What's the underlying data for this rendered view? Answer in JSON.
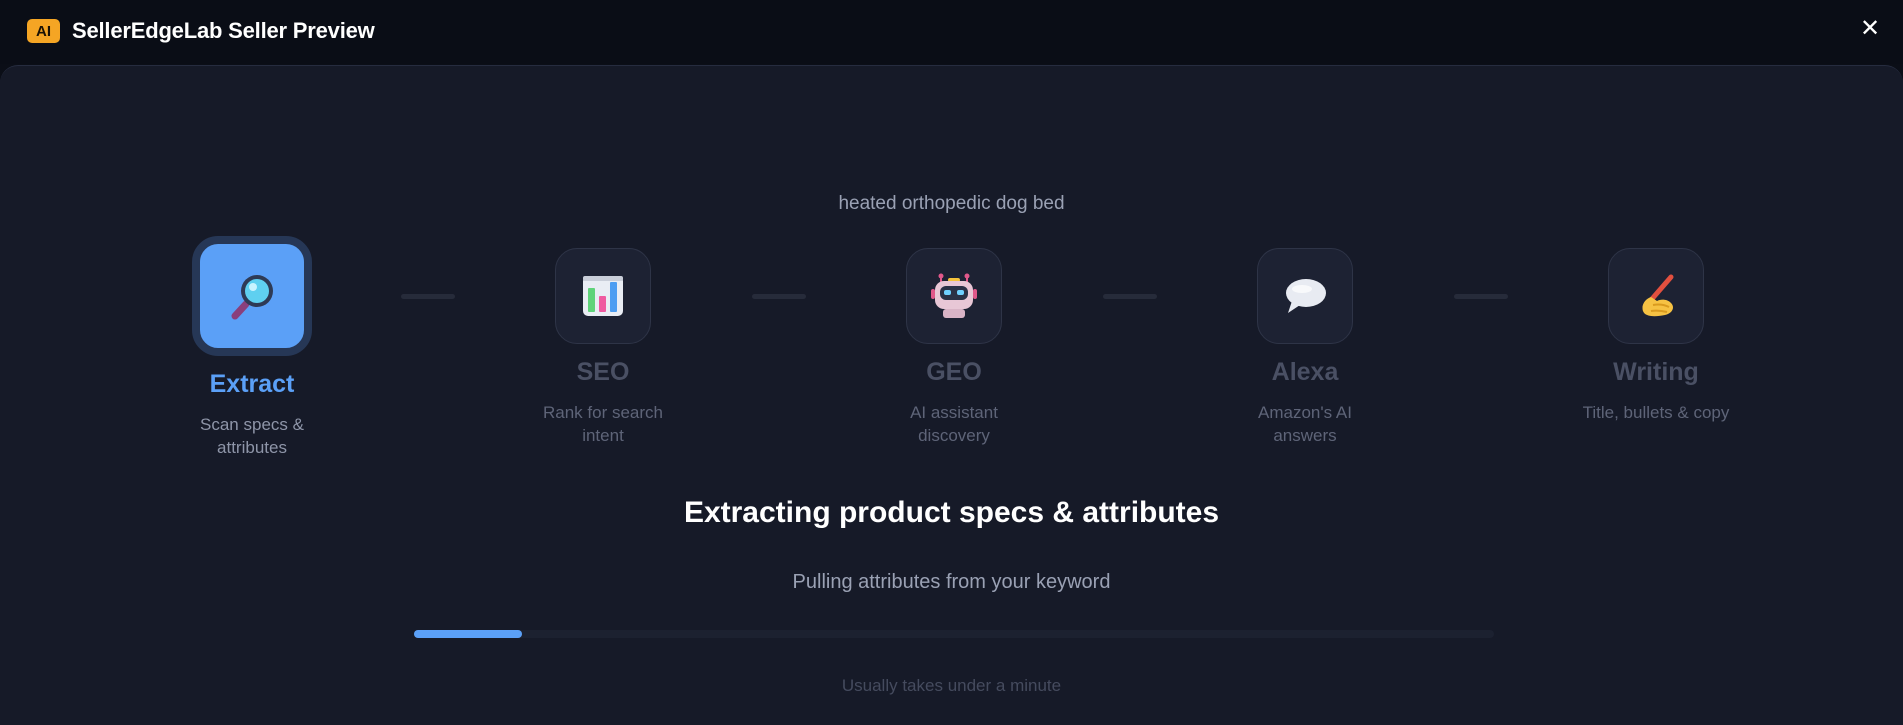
{
  "header": {
    "badge": "AI",
    "title": "SellerEdgeLab Seller Preview",
    "close_icon": "close-icon"
  },
  "keyword": "heated orthopedic dog bed",
  "steps": [
    {
      "label": "Extract",
      "description": "Scan specs & attributes",
      "icon": "magnifier-icon",
      "active": true
    },
    {
      "label": "SEO",
      "description": "Rank for search intent",
      "icon": "bar-chart-icon",
      "active": false
    },
    {
      "label": "GEO",
      "description": "AI assistant discovery",
      "icon": "robot-icon",
      "active": false
    },
    {
      "label": "Alexa",
      "description": "Amazon's AI answers",
      "icon": "speech-bubble-icon",
      "active": false
    },
    {
      "label": "Writing",
      "description": "Title, bullets & copy",
      "icon": "writing-hand-icon",
      "active": false
    }
  ],
  "status": {
    "headline": "Extracting product specs & attributes",
    "subline": "Pulling attributes from your keyword",
    "progress_percent": 10,
    "footnote": "Usually takes under a minute"
  },
  "colors": {
    "accent": "#5ba0f7",
    "badge": "#f5a524",
    "background": "#161a28"
  }
}
